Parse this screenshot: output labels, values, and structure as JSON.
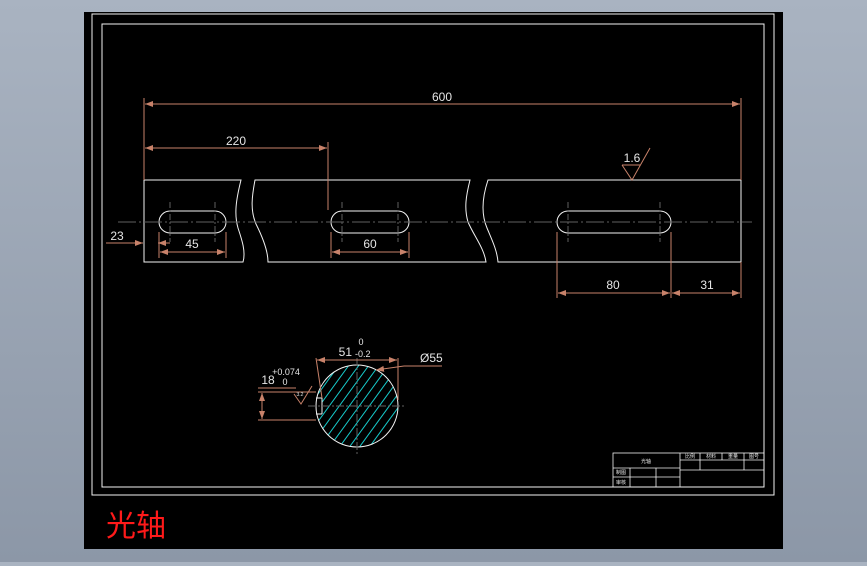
{
  "drawing": {
    "caption": "光轴",
    "dimensions": {
      "overall_length": "600",
      "slot_offset": "220",
      "left_end_offset": "23",
      "slot_1_length": "45",
      "slot_2_length": "60",
      "slot_3_length": "80",
      "right_end_offset": "31",
      "roughness": "1.6"
    },
    "section": {
      "depth_value": "51",
      "depth_upper_tol": "0",
      "depth_lower_tol": "-0.2",
      "diameter": "Ø55",
      "key_width": "18",
      "key_upper_tol": "+0.074",
      "key_lower_tol": "0",
      "key_roughness": "3.2"
    },
    "title_block": {
      "name": "光轴",
      "col_1": "比例",
      "col_2": "材料",
      "col_3": "重量",
      "col_4": "图号",
      "row_1": "制图",
      "row_2": "审核"
    }
  },
  "colors": {
    "canvas": "#000000",
    "frame": "#f2f2f2",
    "dimension_line": "#c8826a",
    "center_line": "#5f5f5f",
    "hatch": "#17c9c9",
    "caption": "#ff1a1a"
  }
}
